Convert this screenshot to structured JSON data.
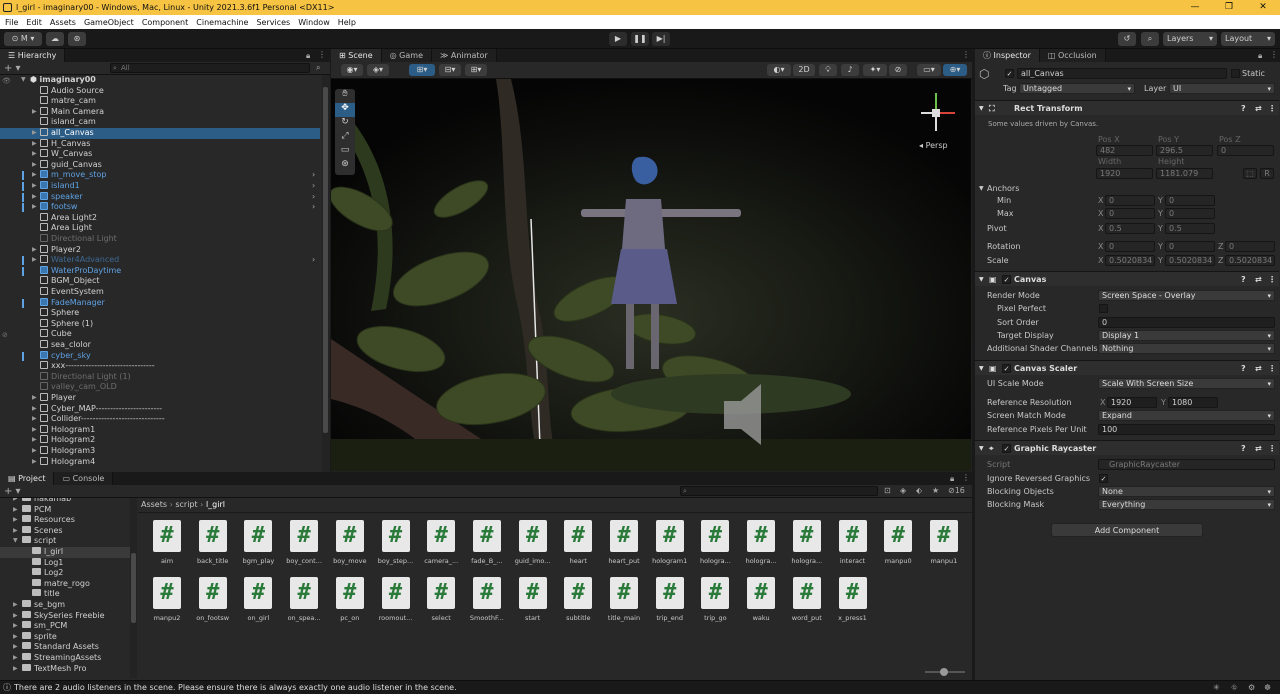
{
  "window": {
    "title": "l_girl - imaginary00 - Windows, Mac, Linux - Unity 2021.3.6f1 Personal <DX11>"
  },
  "menu": [
    "File",
    "Edit",
    "Assets",
    "GameObject",
    "Component",
    "Cinemachine",
    "Services",
    "Window",
    "Help"
  ],
  "toolbar": {
    "account": "M",
    "layers": "Layers",
    "layout": "Layout"
  },
  "hierarchy": {
    "tab": "Hierarchy",
    "search_placeholder": "All",
    "scene": "imaginary00",
    "items": [
      {
        "label": "Audio Source",
        "style": "normal",
        "arrow": false
      },
      {
        "label": "matre_cam",
        "style": "normal",
        "arrow": false
      },
      {
        "label": "Main Camera",
        "style": "normal",
        "arrow": true
      },
      {
        "label": "island_cam",
        "style": "normal",
        "arrow": false
      },
      {
        "label": "all_Canvas",
        "style": "selected",
        "arrow": true
      },
      {
        "label": "H_Canvas",
        "style": "normal",
        "arrow": true
      },
      {
        "label": "W_Canvas",
        "style": "normal",
        "arrow": true
      },
      {
        "label": "guid_Canvas",
        "style": "normal",
        "arrow": true
      },
      {
        "label": "m_move_stop",
        "style": "blue",
        "arrow": true
      },
      {
        "label": "island1",
        "style": "blue",
        "arrow": true
      },
      {
        "label": "speaker",
        "style": "blue",
        "arrow": true
      },
      {
        "label": "footsw",
        "style": "blue",
        "arrow": true
      },
      {
        "label": "Area Light2",
        "style": "normal",
        "arrow": false
      },
      {
        "label": "Area Light",
        "style": "normal",
        "arrow": false
      },
      {
        "label": "Directional Light",
        "style": "dim",
        "arrow": false
      },
      {
        "label": "Player2",
        "style": "normal",
        "arrow": true
      },
      {
        "label": "Water4Advanced",
        "style": "dimblue",
        "arrow": true
      },
      {
        "label": "WaterProDaytime",
        "style": "blue",
        "arrow": false
      },
      {
        "label": "BGM_Object",
        "style": "normal",
        "arrow": false
      },
      {
        "label": "EventSystem",
        "style": "normal",
        "arrow": false
      },
      {
        "label": "FadeManager",
        "style": "blue",
        "arrow": false
      },
      {
        "label": "Sphere",
        "style": "normal",
        "arrow": false
      },
      {
        "label": "Sphere (1)",
        "style": "normal",
        "arrow": false
      },
      {
        "label": "Cube",
        "style": "normal",
        "arrow": false
      },
      {
        "label": "sea_clolor",
        "style": "normal",
        "arrow": false
      },
      {
        "label": "cyber_sky",
        "style": "blue",
        "arrow": false
      },
      {
        "label": "xxx-------------------------------",
        "style": "normal",
        "arrow": false
      },
      {
        "label": "Directional Light (1)",
        "style": "dim",
        "arrow": false
      },
      {
        "label": "valley_cam_OLD",
        "style": "dim",
        "arrow": false
      },
      {
        "label": "Player",
        "style": "normal",
        "arrow": true
      },
      {
        "label": "Cyber_MAP-----------------------",
        "style": "normal",
        "arrow": true
      },
      {
        "label": "Collider-----------------------------",
        "style": "normal",
        "arrow": true
      },
      {
        "label": "Hologram1",
        "style": "normal",
        "arrow": true
      },
      {
        "label": "Hologram2",
        "style": "normal",
        "arrow": true
      },
      {
        "label": "Hologram3",
        "style": "normal",
        "arrow": true
      },
      {
        "label": "Hologram4",
        "style": "normal",
        "arrow": true
      }
    ]
  },
  "scene_view": {
    "tabs": [
      "Scene",
      "Game",
      "Animator"
    ],
    "mode_2d": "2D",
    "gizmo_label": "Persp"
  },
  "inspector": {
    "tabs": [
      "Inspector",
      "Occlusion"
    ],
    "object_name": "all_Canvas",
    "static_label": "Static",
    "tag_label": "Tag",
    "tag_value": "Untagged",
    "layer_label": "Layer",
    "layer_value": "UI",
    "rect_transform": {
      "title": "Rect Transform",
      "note": "Some values driven by Canvas.",
      "pos_x_label": "Pos X",
      "pos_y_label": "Pos Y",
      "pos_z_label": "Pos Z",
      "pos_x": "482",
      "pos_y": "296.5",
      "pos_z": "0",
      "width_label": "Width",
      "height_label": "Height",
      "width": "1920",
      "height": "1181.079",
      "r_button": "R",
      "anchors_label": "Anchors",
      "min_label": "Min",
      "max_label": "Max",
      "min_x": "0",
      "min_y": "0",
      "max_x": "0",
      "max_y": "0",
      "pivot_label": "Pivot",
      "pivot_x": "0.5",
      "pivot_y": "0.5",
      "rotation_label": "Rotation",
      "rot_x": "0",
      "rot_y": "0",
      "rot_z": "0",
      "scale_label": "Scale",
      "scale_x": "0.5020834",
      "scale_y": "0.5020834",
      "scale_z": "0.5020834",
      "x": "X",
      "y": "Y",
      "z": "Z"
    },
    "canvas": {
      "title": "Canvas",
      "render_mode_label": "Render Mode",
      "render_mode": "Screen Space - Overlay",
      "pixel_perfect_label": "Pixel Perfect",
      "sort_order_label": "Sort Order",
      "sort_order": "0",
      "target_display_label": "Target Display",
      "target_display": "Display 1",
      "shader_channels_label": "Additional Shader Channels",
      "shader_channels": "Nothing"
    },
    "canvas_scaler": {
      "title": "Canvas Scaler",
      "ui_scale_mode_label": "UI Scale Mode",
      "ui_scale_mode": "Scale With Screen Size",
      "ref_res_label": "Reference Resolution",
      "ref_x": "1920",
      "ref_y": "1080",
      "match_mode_label": "Screen Match Mode",
      "match_mode": "Expand",
      "ppu_label": "Reference Pixels Per Unit",
      "ppu": "100"
    },
    "graphic_raycaster": {
      "title": "Graphic Raycaster",
      "script_label": "Script",
      "script": "GraphicRaycaster",
      "ignore_reversed_label": "Ignore Reversed Graphics",
      "blocking_objects_label": "Blocking Objects",
      "blocking_objects": "None",
      "blocking_mask_label": "Blocking Mask",
      "blocking_mask": "Everything"
    },
    "add_component": "Add Component"
  },
  "project": {
    "tabs": [
      "Project",
      "Console"
    ],
    "breadcrumb": [
      "Assets",
      "script",
      "l_girl"
    ],
    "count": "16",
    "folders": [
      {
        "label": "nakamab",
        "indent": 1
      },
      {
        "label": "PCM",
        "indent": 1
      },
      {
        "label": "Resources",
        "indent": 1
      },
      {
        "label": "Scenes",
        "indent": 1
      },
      {
        "label": "script",
        "indent": 1
      },
      {
        "label": "l_girl",
        "indent": 2,
        "selected": true
      },
      {
        "label": "Log1",
        "indent": 2
      },
      {
        "label": "Log2",
        "indent": 2
      },
      {
        "label": "matre_rogo",
        "indent": 2
      },
      {
        "label": "title",
        "indent": 2
      },
      {
        "label": "se_bgm",
        "indent": 1
      },
      {
        "label": "SkySeries Freebie",
        "indent": 1
      },
      {
        "label": "sm_PCM",
        "indent": 1
      },
      {
        "label": "sprite",
        "indent": 1
      },
      {
        "label": "Standard Assets",
        "indent": 1
      },
      {
        "label": "StreamingAssets",
        "indent": 1
      },
      {
        "label": "TextMesh Pro",
        "indent": 1
      }
    ],
    "assets": [
      "aim",
      "back_title",
      "bgm_play",
      "boy_cont...",
      "boy_move",
      "boy_step...",
      "camera_...",
      "fade_B_...",
      "guid_imo...",
      "heart",
      "heart_put",
      "hologram1",
      "hologra...",
      "hologra...",
      "hologra...",
      "interact",
      "manpu0",
      "manpu1",
      "manpu2",
      "on_footsw",
      "on_girl",
      "on_spea...",
      "pc_on",
      "roomout...",
      "select",
      "SmoothF...",
      "start",
      "subtitle",
      "title_main",
      "trip_end",
      "trip_go",
      "waku",
      "word_put",
      "x_press1"
    ],
    "script_glyph": "#"
  },
  "status": {
    "message": "There are 2 audio listeners in the scene. Please ensure there is always exactly one audio listener in the scene."
  },
  "colors": {
    "title_bar": "#f6c342",
    "selection": "#2c5d87",
    "prefab_blue": "#5ea2e4"
  }
}
